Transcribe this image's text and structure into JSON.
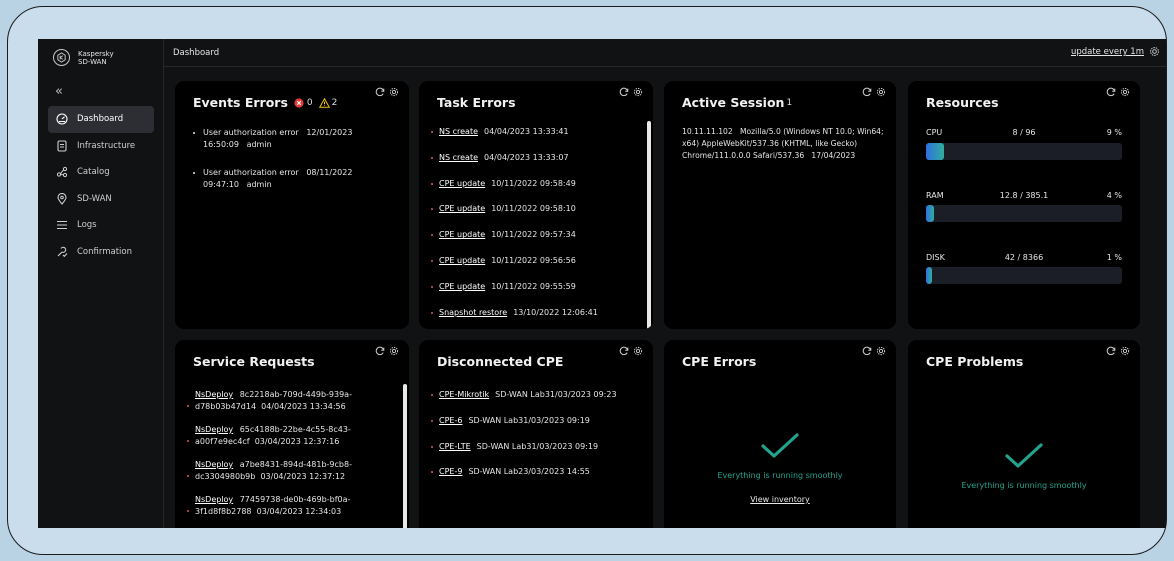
{
  "brand": {
    "line1": "Kaspersky",
    "line2": "SD-WAN"
  },
  "sidebar": {
    "collapse": "«",
    "items": [
      {
        "label": "Dashboard",
        "icon": "gauge-icon"
      },
      {
        "label": "Infrastructure",
        "icon": "document-icon"
      },
      {
        "label": "Catalog",
        "icon": "share-icon"
      },
      {
        "label": "SD-WAN",
        "icon": "location-pin-icon"
      },
      {
        "label": "Logs",
        "icon": "list-icon"
      },
      {
        "label": "Confirmation",
        "icon": "wrench-check-icon"
      }
    ]
  },
  "topbar": {
    "breadcrumb": "Dashboard",
    "update": "update every 1m"
  },
  "events": {
    "title": "Events Errors",
    "errors": "0",
    "warnings": "2",
    "items": [
      {
        "text": "User authorization error",
        "date": "12/01/2023",
        "time": "16:50:09",
        "user": "admin"
      },
      {
        "text": "User authorization error",
        "date": "08/11/2022",
        "time": "09:47:10",
        "user": "admin"
      }
    ]
  },
  "tasks": {
    "title": "Task Errors",
    "items": [
      {
        "name": "NS create",
        "ts": "04/04/2023 13:33:41"
      },
      {
        "name": "NS create",
        "ts": "04/04/2023 13:33:07"
      },
      {
        "name": "CPE update",
        "ts": "10/11/2022 09:58:49"
      },
      {
        "name": "CPE update",
        "ts": "10/11/2022 09:58:10"
      },
      {
        "name": "CPE update",
        "ts": "10/11/2022 09:57:34"
      },
      {
        "name": "CPE update",
        "ts": "10/11/2022 09:56:56"
      },
      {
        "name": "CPE update",
        "ts": "10/11/2022 09:55:59"
      },
      {
        "name": "Snapshot restore",
        "ts": "13/10/2022 12:06:41"
      }
    ]
  },
  "session": {
    "title": "Active Session",
    "count": "1",
    "ip": "10.11.11.102",
    "agent": "Mozilla/5.0 (Windows NT 10.0; Win64; x64) AppleWebKit/537.36 (KHTML, like Gecko) Chrome/111.0.0.0 Safari/537.36",
    "date": "17/04/2023"
  },
  "resources": {
    "title": "Resources",
    "rows": [
      {
        "label": "CPU",
        "value": "8 / 96",
        "pct": "9 %",
        "fraction": 0.09
      },
      {
        "label": "RAM",
        "value": "12.8 / 385.1",
        "pct": "4 %",
        "fraction": 0.04
      },
      {
        "label": "DISK",
        "value": "42 / 8366",
        "pct": "1 %",
        "fraction": 0.01
      }
    ]
  },
  "service": {
    "title": "Service Requests",
    "items": [
      {
        "name": "NsDeploy",
        "id1": "8c2218ab-709d-449b-939a-",
        "id2": "d78b03b47d14",
        "ts": "04/04/2023 13:34:56"
      },
      {
        "name": "NsDeploy",
        "id1": "65c4188b-22be-4c55-8c43-",
        "id2": "a00f7e9ec4cf",
        "ts": "03/04/2023 12:37:16"
      },
      {
        "name": "NsDeploy",
        "id1": "a7be8431-894d-481b-9cb8-",
        "id2": "dc3304980b9b",
        "ts": "03/04/2023 12:37:12"
      },
      {
        "name": "NsDeploy",
        "id1": "77459738-de0b-469b-bf0a-",
        "id2": "3f1d8f8b2788",
        "ts": "03/04/2023 12:34:03"
      }
    ]
  },
  "disconnected": {
    "title": "Disconnected CPE",
    "items": [
      {
        "name": "CPE-Mikrotik",
        "site": "SD-WAN Lab",
        "ts": "31/03/2023 09:23"
      },
      {
        "name": "CPE-6",
        "site": "SD-WAN Lab",
        "ts": "31/03/2023 09:19"
      },
      {
        "name": "CPE-LTE",
        "site": "SD-WAN Lab",
        "ts": "31/03/2023 09:19"
      },
      {
        "name": "CPE-9",
        "site": "SD-WAN Lab",
        "ts": "23/03/2023 14:55"
      }
    ]
  },
  "cpe_errors": {
    "title": "CPE Errors",
    "message": "Everything is running smoothly",
    "link": "View inventory"
  },
  "cpe_problems": {
    "title": "CPE Problems",
    "message": "Everything is running smoothly"
  },
  "colors": {
    "accent": "#23a38e",
    "error": "#e53935",
    "warning": "#f2c200",
    "background": "#111214",
    "card": "#000000"
  }
}
